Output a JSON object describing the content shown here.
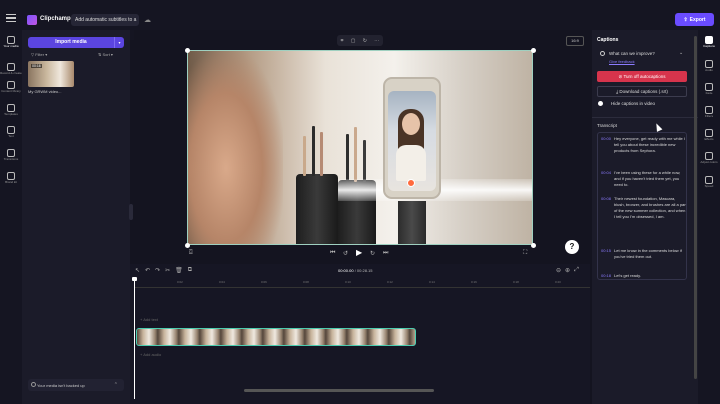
{
  "app": {
    "name": "Clipchamp",
    "project_title": "Add automatic subtitles to a",
    "export_label": "Export"
  },
  "left_rail": [
    {
      "label": "Your media",
      "icon": "folder-icon",
      "active": true
    },
    {
      "label": "Record & create",
      "icon": "record-icon"
    },
    {
      "label": "Content library",
      "icon": "library-icon"
    },
    {
      "label": "Templates",
      "icon": "templates-icon"
    },
    {
      "label": "Text",
      "icon": "text-icon"
    },
    {
      "label": "Transitions",
      "icon": "transitions-icon"
    },
    {
      "label": "Brand kit",
      "icon": "brand-kit-icon"
    }
  ],
  "media": {
    "import_label": "Import media",
    "filter_label": "Filter",
    "sort_label": "Sort",
    "thumb_duration": "00:16",
    "thumb_name": "My GRWM video...",
    "backup_text": "Your media isn't backed up"
  },
  "preview": {
    "aspect_ratio": "16:9",
    "current_time": "00:00.00",
    "total_time": "00:28.15"
  },
  "timeline": {
    "ticks": [
      "0:02",
      "0:04",
      "0:06",
      "0:08",
      "0:10",
      "0:12",
      "0:14",
      "0:16",
      "0:18",
      "0:20",
      "0:22",
      "0:24",
      "0:26",
      "0:28"
    ],
    "text_track_label": "+ Add text",
    "audio_track_label": "+ Add audio"
  },
  "captions": {
    "title": "Captions",
    "improve_label": "What can we improve?",
    "feedback_link": "Give feedback",
    "turn_off_label": "Turn off autocaptions",
    "download_label": "Download captions (.srt)",
    "hide_label": "Hide captions in video",
    "transcript_heading": "Transcript",
    "transcript": [
      {
        "time": "00:00",
        "text": "Hey everyone, get ready with me while I tell you about these incredible new products from Sephora."
      },
      {
        "time": "00:04",
        "text": "I've been using these for a while now, and if you haven't tried them yet, you need to."
      },
      {
        "time": "00:08",
        "text": "Their newest foundation, Mascara, blush, bronzer, and brushes are all a part of the new summer collection, and when I tell you I'm obsessed, I am."
      },
      {
        "time": "00:15",
        "text": "Let me know in the comments below if you've tried them out."
      },
      {
        "time": "00:18",
        "text": "Let's get ready."
      }
    ]
  },
  "right_rail": [
    {
      "label": "Captions",
      "icon": "captions-icon",
      "active": true
    },
    {
      "label": "Audio",
      "icon": "audio-icon"
    },
    {
      "label": "Fade",
      "icon": "fade-icon"
    },
    {
      "label": "Filters",
      "icon": "filters-icon"
    },
    {
      "label": "Effects",
      "icon": "effects-icon"
    },
    {
      "label": "Adjust colors",
      "icon": "adjust-colors-icon"
    },
    {
      "label": "Speed",
      "icon": "speed-icon"
    }
  ]
}
